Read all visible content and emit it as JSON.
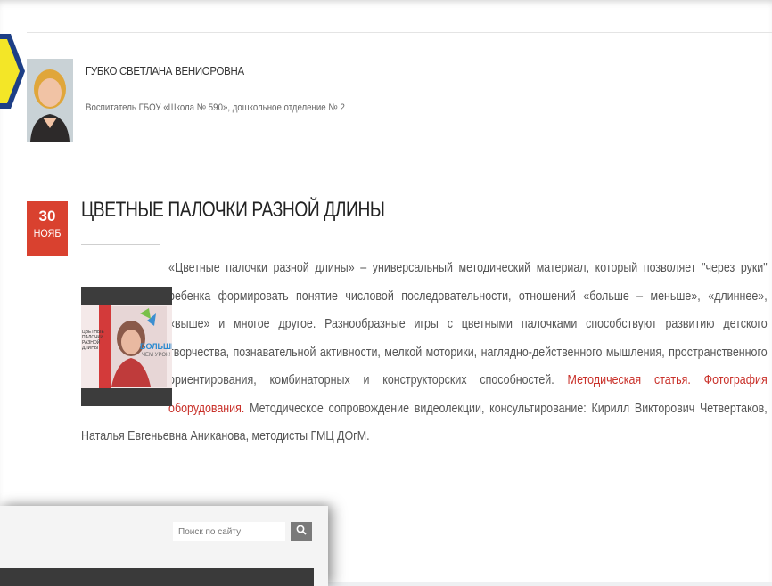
{
  "author": {
    "name": "ГУБКО СВЕТЛАНА ВЕНИОРОВНА",
    "role": "Воспитатель ГБОУ «Школа № 590», дошкольное отделение № 2"
  },
  "post": {
    "date_day": "30",
    "date_month": "НОЯБ",
    "title": "ЦВЕТНЫЕ ПАЛОЧКИ РАЗНОЙ ДЛИНЫ",
    "thumbnail": {
      "left_text": "ЦВЕТНЫЕ ПАЛОЧКИ РАЗНОЙ ДЛИНЫ",
      "brand_big": "БОЛЬШЕ",
      "brand_small": "ЧЕМ УРОК!"
    },
    "text_part1": "«Цветные палочки разной длины» – универсальный методический материал, который позволяет \"через руки\" ребенка формировать понятие числовой последовательности, отношений «больше – меньше», «длиннее», «выше» и многое другое. Разнообразные игры с цветными палочками способствуют развитию детского творчества, познавательной активности, мелкой моторики, наглядно-действенного мышления, пространственного ориентирования, комбинаторных и конструкторских способностей.",
    "link1": "Методическая статья.",
    "link2": "Фотография оборудования.",
    "text_part2": "Методическое сопровождение видеолекции, консультирование: Кирилл Викторович Четвертаков, Наталья Евгеньевна Аниканова, методисты ГМЦ ДОгМ."
  },
  "search": {
    "placeholder": "Поиск по сайту"
  },
  "colors": {
    "accent": "#d9412f",
    "link": "#c9312a",
    "badge_yellow": "#f3e627",
    "badge_blue": "#1d3f86"
  }
}
